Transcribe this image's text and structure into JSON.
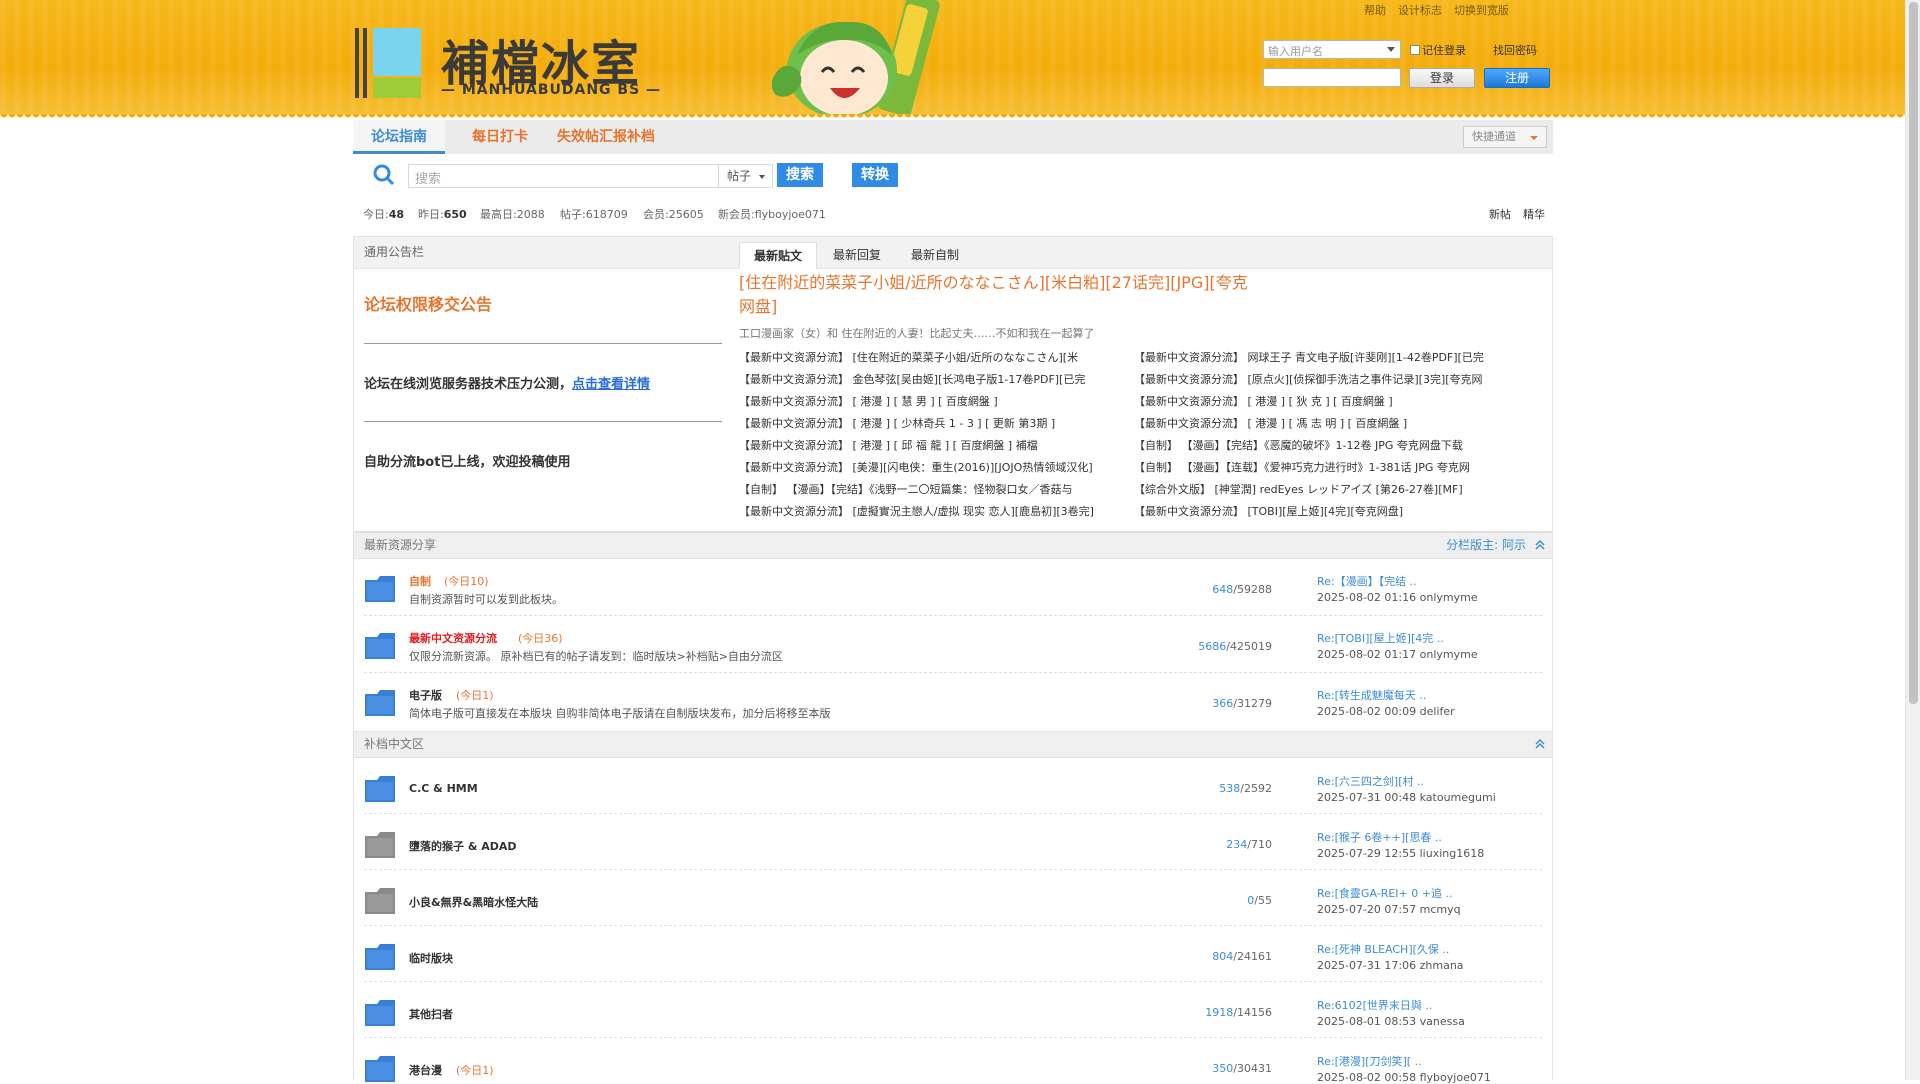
{
  "header": {
    "logo_name": "補檔冰室",
    "logo_sub": "— MANHUABUDANG BS —",
    "top_links": [
      "帮助",
      "设计标志",
      "切换到宽版"
    ],
    "login": {
      "user_placeholder": "输入用户名",
      "remember": "记住登录",
      "forgot": "找回密码",
      "login_btn": "登录",
      "register_btn": "注册"
    }
  },
  "nav": {
    "items": [
      "论坛指南",
      "每日打卡",
      "失效帖汇报补档"
    ],
    "quick": "快捷通道"
  },
  "search": {
    "placeholder": "搜索",
    "type": "帖子",
    "go": "搜索",
    "convert": "转换"
  },
  "stats": {
    "today_label": "今日:",
    "today": "48",
    "yesterday_label": "昨日:",
    "yesterday": "650",
    "max_label": "最高日:",
    "max": "2088",
    "posts_label": "帖子:",
    "posts": "618709",
    "members_label": "会员:",
    "members": "25605",
    "newest_label": "新会员:",
    "newest": "flyboyjoe071",
    "new_posts": "新帖",
    "digest": "精华"
  },
  "panel": {
    "left_head": "通用公告栏",
    "tabs": [
      "最新贴文",
      "最新回复",
      "最新自制"
    ],
    "ann_title": "论坛权限移交公告",
    "ann_line2": "论坛在线浏览服务器技术压力公测，",
    "ann_link": "点击查看详情",
    "ann_line3": "自助分流bot已上线，欢迎投稿使用",
    "feature_title": "[住在附近的菜菜子小姐/近所のななこさん][米白粕][27话完][JPG][夸克网盘]",
    "feature_desc": "工口漫画家（女）和 住在附近的人妻！比起丈夫……不如和我在一起算了",
    "posts_left": [
      "【最新中文资源分流】 [住在附近的菜菜子小姐/近所のななこさん][米",
      "【最新中文资源分流】 金色琴弦[吴由姬][长鸿电子版1-17卷PDF][已完",
      "【最新中文资源分流】 [ 港漫 ] [ 慧 男 ] [ 百度網盤 ]",
      "【最新中文资源分流】 [ 港漫 ] [ 少林奇兵 1 - 3 ] [ 更新 第3期 ]",
      "【最新中文资源分流】 [ 港漫 ] [ 邱 福 龍 ] [ 百度網盤 ] 補檔",
      "【最新中文资源分流】 [美漫][闪电侠：重生(2016)][JOJO热情领域汉化]",
      "【自制】 【漫画】【完结】《浅野一二〇短篇集：怪物裂口女／香菇与",
      "【最新中文资源分流】 [虚擬實況主戀人/虚拟 现实 恋人][鹿島初][3卷完]"
    ],
    "posts_right": [
      "【最新中文资源分流】 网球王子 青文电子版[许斐刚][1-42卷PDF][已完",
      "【最新中文资源分流】 [原点火][侦探御手洗洁之事件记录][3完][夸克网",
      "【最新中文资源分流】 [ 港漫 ] [ 狄 克 ] [ 百度網盤 ]",
      "【最新中文资源分流】 [ 港漫 ] [ 馮 志 明 ] [ 百度網盤 ]",
      "【自制】 【漫画】【完结】《恶魔的破坏》1-12卷 JPG 夸克网盘下载",
      "【自制】 【漫画】【连载】《爱神巧克力进行时》1-381话 JPG 夸克网",
      "【综合外文版】 [神堂潤] redEyes レッドアイズ [第26-27卷][MF]",
      "【最新中文资源分流】 [TOBI][屋上姬][4完][夸克网盘]"
    ]
  },
  "sections": [
    {
      "title": "最新资源分享",
      "mods": "分栏版主: 阿示"
    },
    {
      "title": "补档中文区",
      "mods": ""
    }
  ],
  "forums_a": [
    {
      "name": "自制",
      "today": "(今日10)",
      "desc": "自制资源暂时可以发到此板块。",
      "threads": "648",
      "posts": "/59288",
      "last": "Re:【漫画】【完结 ..",
      "meta": "2025-08-02 01:16 onlymyme"
    },
    {
      "name": "最新中文资源分流",
      "today": "(今日36)",
      "desc": "仅限分流新资源。 原补档已有的帖子请发到：临时版块>补档贴>自由分流区",
      "threads": "5686",
      "posts": "/425019",
      "last": "Re:[TOBI][屋上姬][4完 ..",
      "meta": "2025-08-02 01:17 onlymyme"
    },
    {
      "name": "电子版",
      "today": "(今日1)",
      "desc": "简体电子版可直接发在本版块 自购非简体电子版请在自制版块发布，加分后将移至本版",
      "threads": "366",
      "posts": "/31279",
      "last": "Re:[转生成魅魔每天 ..",
      "meta": "2025-08-02 00:09 delifer"
    }
  ],
  "forums_b": [
    {
      "name": "C.C & HMM",
      "today": "",
      "desc": "",
      "threads": "538",
      "posts": "/2592",
      "last": "Re:[六三四之剑][村 ..",
      "meta": "2025-07-31 00:48 katoumegumi"
    },
    {
      "name": "墮落的猴子 & ADAD",
      "today": "",
      "desc": "",
      "threads": "234",
      "posts": "/710",
      "last": "Re:[猴子 6卷++][思春 ..",
      "meta": "2025-07-29 12:55 liuxing1618"
    },
    {
      "name": "小良&無界&黑暗水怪大陆",
      "today": "",
      "desc": "",
      "threads": "0",
      "posts": "/55",
      "last": "Re:[食靈GA-REI+ 0 +追 ..",
      "meta": "2025-07-20 07:57 mcmyq"
    },
    {
      "name": "临时版块",
      "today": "",
      "desc": "",
      "threads": "804",
      "posts": "/24161",
      "last": "Re:[死神 BLEACH][久保 ..",
      "meta": "2025-07-31 17:06 zhmana"
    },
    {
      "name": "其他扫者",
      "today": "",
      "desc": "",
      "threads": "1918",
      "posts": "/14156",
      "last": "Re:6102[世界末日與 ..",
      "meta": "2025-08-01 08:53 vanessa"
    },
    {
      "name": "港台漫",
      "today": "(今日1)",
      "desc": "",
      "threads": "350",
      "posts": "/30431",
      "last": "Re:[港漫][刀剑笑][ ..",
      "meta": "2025-08-02 00:58 flyboyjoe071"
    }
  ],
  "colors": {
    "accent": "#e6762f",
    "link": "#3c8dd6",
    "header": "#f4ac0b",
    "button": "#2f8be6"
  },
  "icons": [
    "search-icon",
    "forum-icon",
    "collapse-icon",
    "mascot-image"
  ]
}
